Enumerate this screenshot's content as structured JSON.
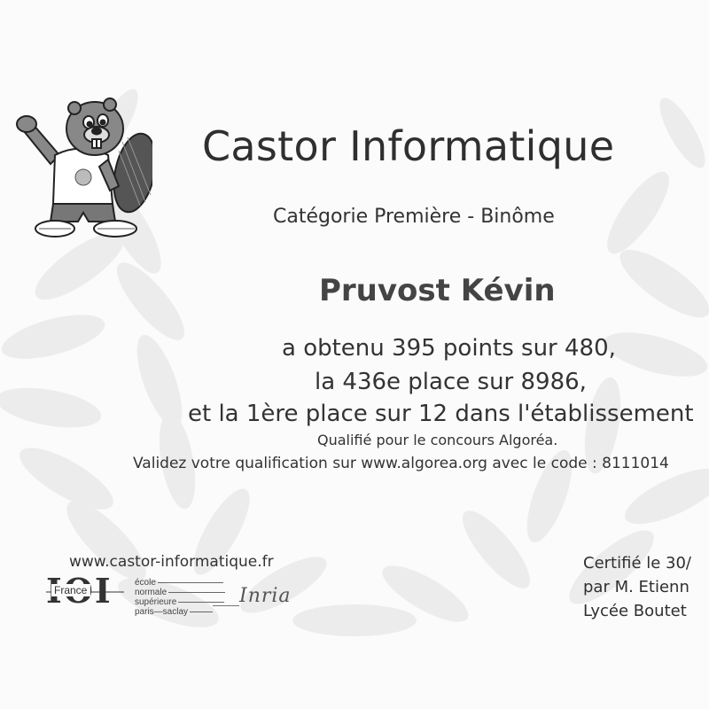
{
  "certificate": {
    "title": "Castor Informatique",
    "category": "Catégorie Première - Binôme",
    "name": "Pruvost Kévin",
    "line1": "a obtenu 395 points sur 480,",
    "line2": "la 436e place sur 8986,",
    "line3": "et la 1ère place sur 12 dans l'établissement",
    "line4": "Qualifié pour le concours Algoréa.",
    "line5": "Validez votre qualification sur www.algorea.org avec le code : 8111014"
  },
  "footer": {
    "website": "www.castor-informatique.fr",
    "ioi_letters": "IOI",
    "ioi_country": "France",
    "ens_lines": [
      "école",
      "normale",
      "supérieure",
      "paris—saclay"
    ],
    "inria": "Inria",
    "certified_line1": "Certifié le 30/",
    "certified_line2": "par M. Etienn",
    "certified_line3": "Lycée Boutet"
  },
  "icons": {
    "mascot": "beaver-mascot-icon",
    "wreath": "laurel-wreath-background",
    "ioi_logo": "ioi-france-logo",
    "ens_logo": "ens-paris-saclay-logo",
    "inria_logo": "inria-logo"
  }
}
